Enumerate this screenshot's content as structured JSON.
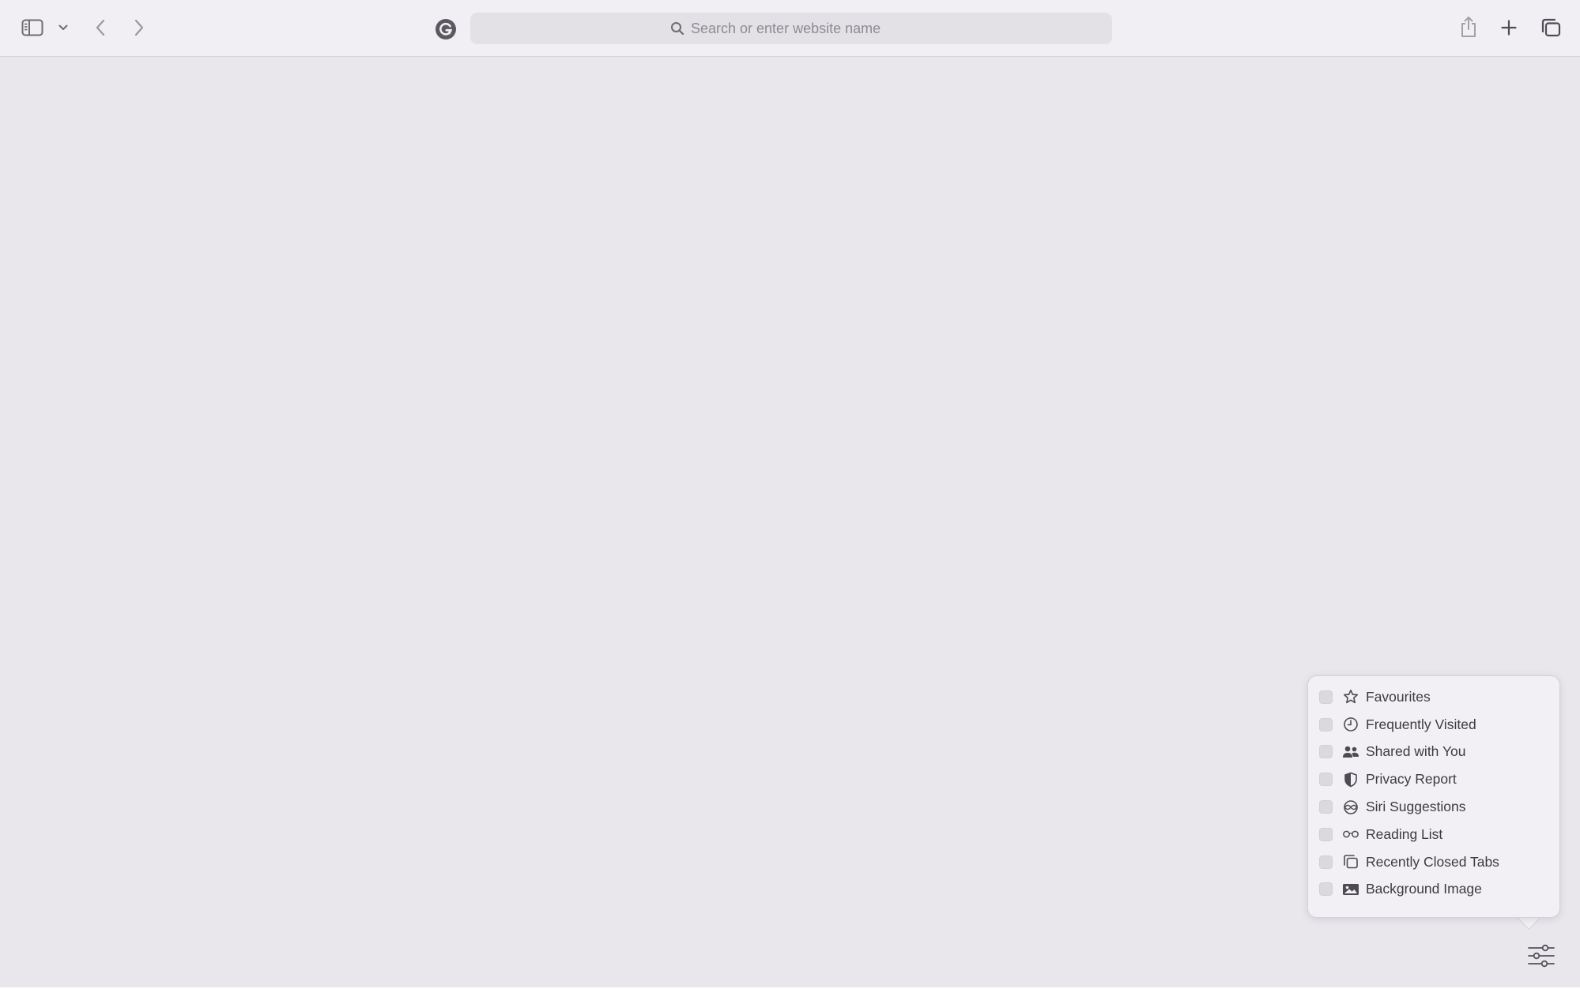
{
  "toolbar": {
    "search_placeholder": "Search or enter website name",
    "icons": {
      "sidebar": "sidebar-icon",
      "sidebar_menu": "chevron-down-icon",
      "back": "chevron-left-icon",
      "forward": "chevron-right-icon",
      "extension": "grammarly-icon",
      "share": "share-icon",
      "new_tab": "plus-icon",
      "tab_overview": "tab-overview-icon"
    }
  },
  "customize_menu": {
    "items": [
      {
        "label": "Favourites",
        "icon": "star-icon",
        "checked": false
      },
      {
        "label": "Frequently Visited",
        "icon": "clock-icon",
        "checked": false
      },
      {
        "label": "Shared with You",
        "icon": "people-icon",
        "checked": false
      },
      {
        "label": "Privacy Report",
        "icon": "shield-icon",
        "checked": false
      },
      {
        "label": "Siri Suggestions",
        "icon": "siri-icon",
        "checked": false
      },
      {
        "label": "Reading List",
        "icon": "glasses-icon",
        "checked": false
      },
      {
        "label": "Recently Closed Tabs",
        "icon": "tabs-icon",
        "checked": false
      },
      {
        "label": "Background Image",
        "icon": "photo-icon",
        "checked": false
      }
    ]
  },
  "colors": {
    "toolbar_bg": "#f2eff4",
    "content_bg": "#e9e7ec",
    "icon": "#6e6b72"
  }
}
